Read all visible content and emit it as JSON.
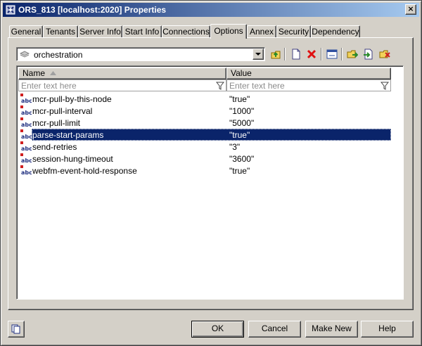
{
  "window": {
    "title": "ORS_813 [localhost:2020] Properties",
    "close_glyph": "×"
  },
  "tabs": [
    {
      "label": "General",
      "active": false
    },
    {
      "label": "Tenants",
      "active": false
    },
    {
      "label": "Server Info",
      "active": false
    },
    {
      "label": "Start Info",
      "active": false
    },
    {
      "label": "Connections",
      "active": false
    },
    {
      "label": "Options",
      "active": true
    },
    {
      "label": "Annex",
      "active": false
    },
    {
      "label": "Security",
      "active": false
    },
    {
      "label": "Dependency",
      "active": false
    }
  ],
  "section": {
    "selected": "orchestration",
    "icon": "section-icon"
  },
  "toolbar": {
    "icons": [
      "up-folder-icon",
      "new-item-icon",
      "delete-icon",
      "edit-icon",
      "export-icon",
      "import-icon",
      "copy-option-icon"
    ]
  },
  "grid": {
    "columns": [
      {
        "label": "Name",
        "sorted": "ascending"
      },
      {
        "label": "Value"
      }
    ],
    "filter_placeholder": "Enter text here",
    "rows": [
      {
        "name": "mcr-pull-by-this-node",
        "value": "\"true\"",
        "selected": false
      },
      {
        "name": "mcr-pull-interval",
        "value": "\"1000\"",
        "selected": false
      },
      {
        "name": "mcr-pull-limit",
        "value": "\"5000\"",
        "selected": false
      },
      {
        "name": "parse-start-params",
        "value": "\"true\"",
        "selected": true
      },
      {
        "name": "send-retries",
        "value": "\"3\"",
        "selected": false
      },
      {
        "name": "session-hung-timeout",
        "value": "\"3600\"",
        "selected": false
      },
      {
        "name": "webfm-event-hold-response",
        "value": "\"true\"",
        "selected": false
      }
    ],
    "row_icon": "abc-string-icon"
  },
  "buttons": {
    "ok": "OK",
    "cancel": "Cancel",
    "make_new": "Make New",
    "help": "Help"
  },
  "colors": {
    "title_bar": "#0a246a",
    "selection": "#0a246a",
    "face": "#d4d0c8"
  }
}
